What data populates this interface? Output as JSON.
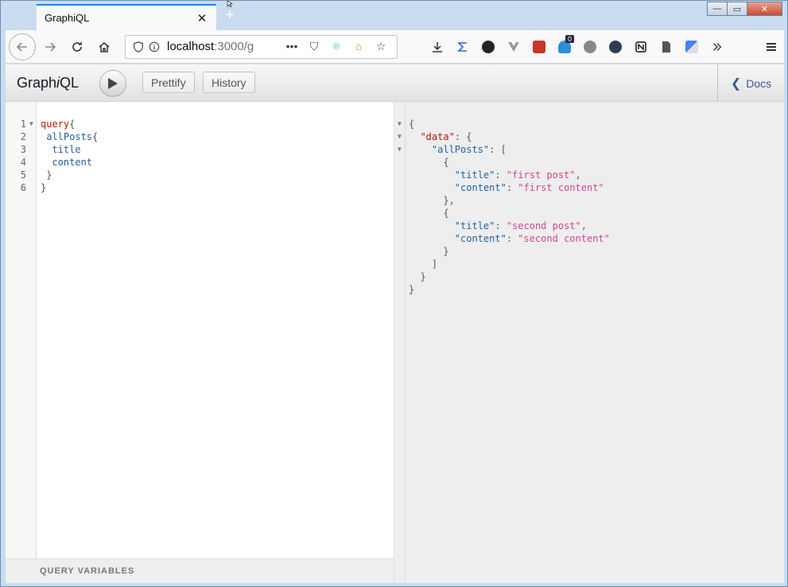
{
  "tab": {
    "title": "GraphiQL",
    "close": "✕",
    "new": "+"
  },
  "window": {
    "minimize": "—",
    "maximize": "▭",
    "close": "✕"
  },
  "url": {
    "host": "localhost",
    "rest": ":3000/g"
  },
  "url_actions": {
    "more": "•••",
    "pocket": "⛉",
    "react": "⚛",
    "house": "⌂",
    "star": "☆"
  },
  "badge": "0",
  "graphiql": {
    "title_a": "Graph",
    "title_i": "i",
    "title_b": "QL",
    "prettify": "Prettify",
    "history": "History",
    "docs": "Docs",
    "docs_chevron": "❮",
    "query_variables": "QUERY VARIABLES"
  },
  "query_lines": [
    {
      "n": "1",
      "fold": "▼",
      "indent": "",
      "tokens": [
        {
          "t": "query",
          "c": "kw"
        },
        {
          "t": "{",
          "c": "pn"
        }
      ]
    },
    {
      "n": "2",
      "fold": "",
      "indent": " ",
      "tokens": [
        {
          "t": "allPosts",
          "c": "fld"
        },
        {
          "t": "{",
          "c": "pn"
        }
      ]
    },
    {
      "n": "3",
      "fold": "",
      "indent": "  ",
      "tokens": [
        {
          "t": "title",
          "c": "fld"
        }
      ]
    },
    {
      "n": "4",
      "fold": "",
      "indent": "  ",
      "tokens": [
        {
          "t": "content",
          "c": "fld"
        }
      ]
    },
    {
      "n": "5",
      "fold": "",
      "indent": " ",
      "tokens": [
        {
          "t": "}",
          "c": "pn"
        }
      ]
    },
    {
      "n": "6",
      "fold": "",
      "indent": "",
      "tokens": [
        {
          "t": "}",
          "c": "pn"
        }
      ]
    }
  ],
  "result_lines": [
    {
      "fold": "▼",
      "indent": "",
      "tokens": [
        {
          "t": "{",
          "c": "pn"
        }
      ]
    },
    {
      "fold": "▼",
      "indent": "  ",
      "tokens": [
        {
          "t": "\"data\"",
          "c": "key"
        },
        {
          "t": ": {",
          "c": "pn"
        }
      ]
    },
    {
      "fold": "▼",
      "indent": "    ",
      "tokens": [
        {
          "t": "\"allPosts\"",
          "c": "key2"
        },
        {
          "t": ": [",
          "c": "pn"
        }
      ]
    },
    {
      "fold": "",
      "indent": "      ",
      "tokens": [
        {
          "t": "{",
          "c": "pn"
        }
      ]
    },
    {
      "fold": "",
      "indent": "        ",
      "tokens": [
        {
          "t": "\"title\"",
          "c": "key2"
        },
        {
          "t": ": ",
          "c": "pn"
        },
        {
          "t": "\"first post\"",
          "c": "str"
        },
        {
          "t": ",",
          "c": "pn"
        }
      ]
    },
    {
      "fold": "",
      "indent": "        ",
      "tokens": [
        {
          "t": "\"content\"",
          "c": "key2"
        },
        {
          "t": ": ",
          "c": "pn"
        },
        {
          "t": "\"first content\"",
          "c": "str"
        }
      ]
    },
    {
      "fold": "",
      "indent": "      ",
      "tokens": [
        {
          "t": "},",
          "c": "pn"
        }
      ]
    },
    {
      "fold": "",
      "indent": "      ",
      "tokens": [
        {
          "t": "{",
          "c": "pn"
        }
      ]
    },
    {
      "fold": "",
      "indent": "        ",
      "tokens": [
        {
          "t": "\"title\"",
          "c": "key2"
        },
        {
          "t": ": ",
          "c": "pn"
        },
        {
          "t": "\"second post\"",
          "c": "str"
        },
        {
          "t": ",",
          "c": "pn"
        }
      ]
    },
    {
      "fold": "",
      "indent": "        ",
      "tokens": [
        {
          "t": "\"content\"",
          "c": "key2"
        },
        {
          "t": ": ",
          "c": "pn"
        },
        {
          "t": "\"second content\"",
          "c": "str"
        }
      ]
    },
    {
      "fold": "",
      "indent": "      ",
      "tokens": [
        {
          "t": "}",
          "c": "pn"
        }
      ]
    },
    {
      "fold": "",
      "indent": "    ",
      "tokens": [
        {
          "t": "]",
          "c": "pn"
        }
      ]
    },
    {
      "fold": "",
      "indent": "  ",
      "tokens": [
        {
          "t": "}",
          "c": "pn"
        }
      ]
    },
    {
      "fold": "",
      "indent": "",
      "tokens": [
        {
          "t": "}",
          "c": "pn"
        }
      ]
    }
  ],
  "colors": {
    "accent": "#0a84ff",
    "docs": "#3b5998",
    "keyword": "#b11a04",
    "field": "#1f61a0",
    "string": "#d64292"
  }
}
